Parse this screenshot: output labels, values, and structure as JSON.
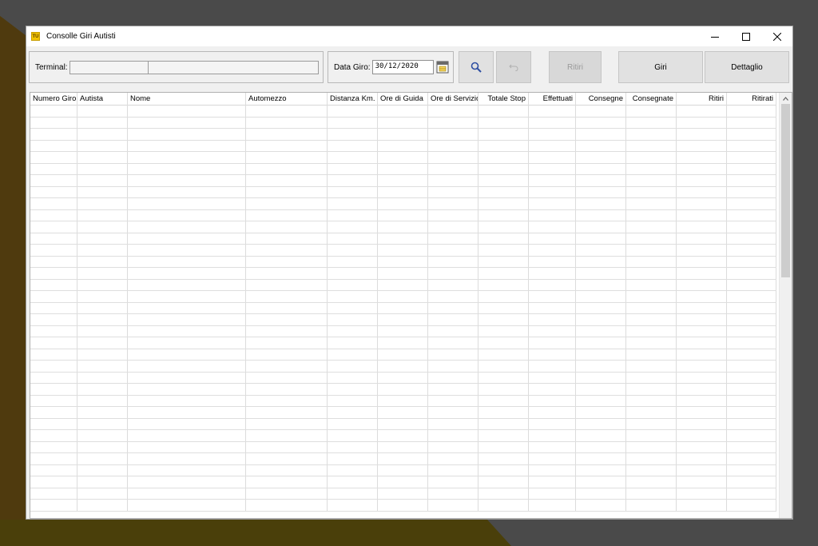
{
  "window": {
    "title": "Consolle Giri Autisti",
    "app_icon_text": "TU"
  },
  "toolbar": {
    "terminal_label": "Terminal:",
    "terminal_code": "",
    "terminal_name": "",
    "date_label": "Data Giro:",
    "date_value": "30/12/2020",
    "ritiri_label": "Ritiri",
    "giri_label": "Giri",
    "dettaglio_label": "Dettaglio"
  },
  "grid": {
    "columns": [
      {
        "label": "Numero Giro",
        "align": "left"
      },
      {
        "label": "Autista",
        "align": "left"
      },
      {
        "label": "Nome",
        "align": "left"
      },
      {
        "label": "Automezzo",
        "align": "left"
      },
      {
        "label": "Distanza Km.",
        "align": "right"
      },
      {
        "label": "Ore di Guida",
        "align": "left"
      },
      {
        "label": "Ore di Servizio",
        "align": "left"
      },
      {
        "label": "Totale Stop",
        "align": "right"
      },
      {
        "label": "Effettuati",
        "align": "right"
      },
      {
        "label": "Consegne",
        "align": "right"
      },
      {
        "label": "Consegnate",
        "align": "right"
      },
      {
        "label": "Ritiri",
        "align": "right"
      },
      {
        "label": "Ritirati",
        "align": "right"
      }
    ],
    "rows": []
  }
}
